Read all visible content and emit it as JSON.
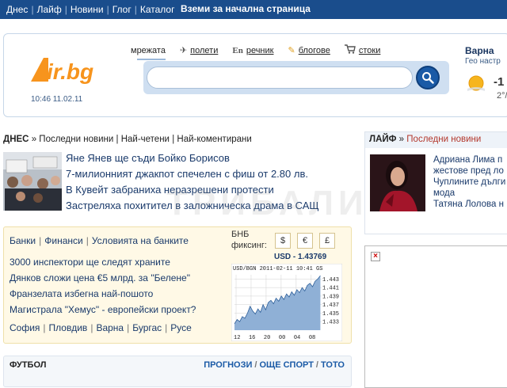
{
  "topbar": {
    "nav": [
      "Днес",
      "Лайф",
      "Новини",
      "Глог",
      "Каталог"
    ],
    "home_button": "Вземи за начална страница"
  },
  "header": {
    "logo_text": "Dir.bg",
    "datetime": "10:46 11.02.11",
    "tabs": [
      {
        "label": "мрежата",
        "icon": "globe-icon"
      },
      {
        "label": "полети",
        "icon": "plane-icon"
      },
      {
        "label": "речник",
        "icon": "en-icon",
        "icon_text": "En"
      },
      {
        "label": "блогове",
        "icon": "pencil-icon"
      },
      {
        "label": "стоки",
        "icon": "cart-icon"
      }
    ],
    "search": {
      "placeholder": ""
    },
    "weather": {
      "city": "Варна",
      "subtitle": "Гео настр",
      "temp": "-1",
      "temp2": "2°/"
    }
  },
  "today": {
    "head_bold": "ДНЕС",
    "head_arrow": "»",
    "links": [
      "Последни новини",
      "Най-четени",
      "Най-коментирани"
    ],
    "items": [
      "Яне Янев ще съди Бойко Борисов",
      "7-милионният джакпот спечелен с фиш от 2.80 лв.",
      "В Кувейт забраниха неразрешени протести",
      "Застреляха похитител в заложническа драма в САЩ"
    ]
  },
  "finance": {
    "tabs": [
      "Банки",
      "Финанси",
      "Условията на банките"
    ],
    "news": [
      "3000 инспектори ще следят храните",
      "Дянков сложи цена €5 млрд. за \"Белене\"",
      "Франзелата избегна най-пошото",
      "Магистрала \"Хемус\" - европейски проект?"
    ],
    "cities": [
      "София",
      "Пловдив",
      "Варна",
      "Бургас",
      "Русе"
    ],
    "bnb_label_1": "БНБ",
    "bnb_label_2": "фиксинг:",
    "currencies": [
      "$",
      "€",
      "£"
    ],
    "usd_rate": "USD - 1.43769"
  },
  "chart_data": {
    "type": "line",
    "title": "USD/BGN 2011-02-11 10:41 GS",
    "x_ticks": [
      "12",
      "16",
      "20",
      "00",
      "04",
      "08"
    ],
    "y_ticks": [
      "1.443",
      "1.441",
      "1.439",
      "1.437",
      "1.435",
      "1.433"
    ],
    "ylim": [
      1.431,
      1.444
    ],
    "x": [
      0,
      4,
      8,
      12,
      16,
      20,
      24,
      28,
      32,
      36,
      40,
      44,
      48,
      52,
      56,
      60,
      64,
      68,
      72,
      76,
      80,
      84,
      88,
      92,
      96,
      100,
      104,
      108,
      112,
      116,
      120,
      124,
      128,
      132
    ],
    "values": [
      1.4325,
      1.4335,
      1.433,
      1.4342,
      1.4338,
      1.435,
      1.4366,
      1.4355,
      1.4348,
      1.436,
      1.4352,
      1.437,
      1.4358,
      1.4375,
      1.438,
      1.4372,
      1.4385,
      1.4378,
      1.439,
      1.4382,
      1.4395,
      1.4388,
      1.44,
      1.4392,
      1.4405,
      1.4398,
      1.441,
      1.4402,
      1.4415,
      1.442,
      1.4412,
      1.4425,
      1.443,
      1.4438
    ],
    "grid": true
  },
  "football": {
    "title": "ФУТБОЛ",
    "links": [
      "ПРОГНОЗИ",
      "ОЩЕ СПОРТ",
      "ТОТО"
    ]
  },
  "life": {
    "head_bold": "ЛАЙФ",
    "head_arrow": "»",
    "head_link": "Последни новини",
    "items": [
      "Адриана Лима п",
      "жестове пред ло",
      "Чуплините дълги",
      "мода",
      "Татяна Лолова н"
    ]
  },
  "ad": {
    "close": "×"
  },
  "watermark": "ТРИБАЛИ",
  "colors": {
    "topbar": "#1a4d8c",
    "accent": "#1a5aa6",
    "logo_orange": "#f7941d",
    "finance_bg": "#fff9e6"
  }
}
